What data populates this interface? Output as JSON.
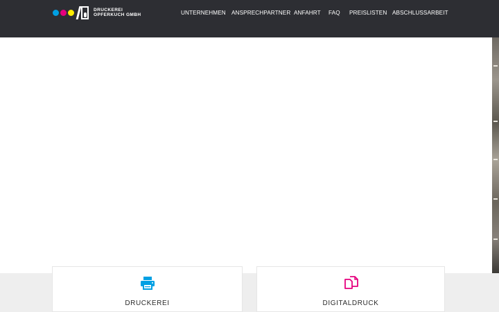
{
  "header": {
    "logo": {
      "line1": "DRUCKEREI",
      "line2": "OPFERKUCH GMBH",
      "dots": [
        "#00a0e3",
        "#e6007e",
        "#ffed00"
      ]
    },
    "nav": [
      {
        "label": "UNTERNEHMEN"
      },
      {
        "label": "ANSPRECHPARTNER"
      },
      {
        "label": "ANFAHRT"
      },
      {
        "label": "FAQ"
      },
      {
        "label": "PREISLISTEN"
      },
      {
        "label": "ABSCHLUSSARBEIT"
      }
    ]
  },
  "services": [
    {
      "title": "DRUCKEREI",
      "icon": "printer-icon",
      "color": "#00a0e3"
    },
    {
      "title": "DIGITALDRUCK",
      "icon": "documents-icon",
      "color": "#e6007e"
    }
  ],
  "colors": {
    "header_bg": "#2d2e33",
    "section_bg": "#eeeeee"
  }
}
